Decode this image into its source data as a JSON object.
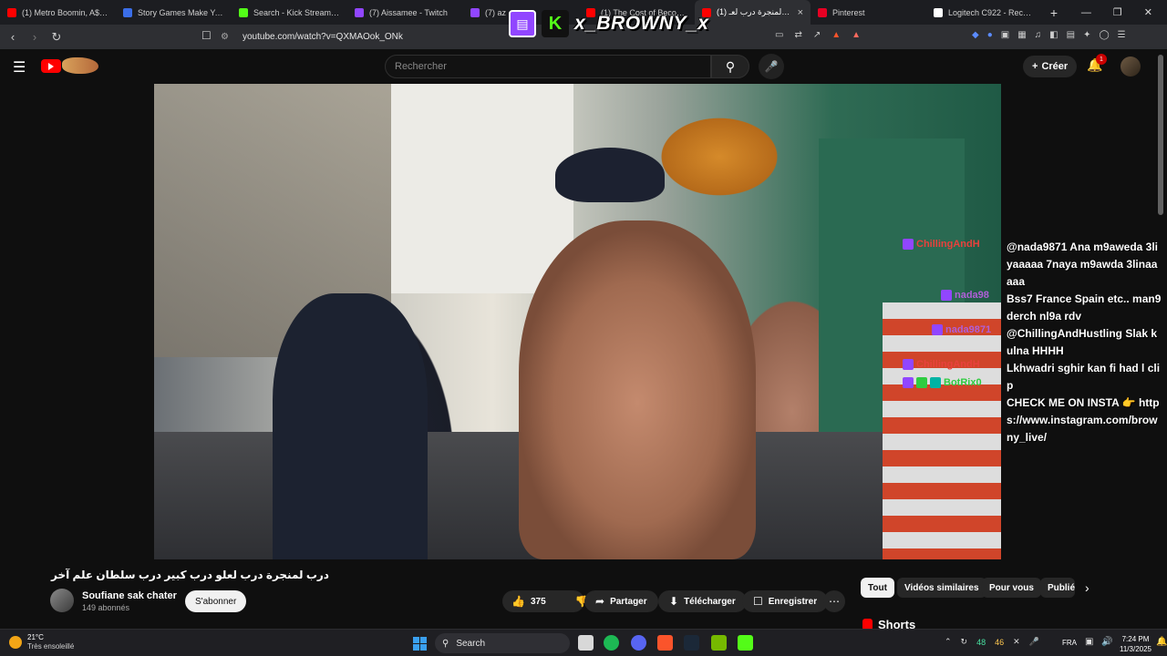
{
  "browser": {
    "tabs": [
      {
        "title": "(1) Metro Boomin, A$AP R",
        "icon": "youtube-icon",
        "color": "#ff0000"
      },
      {
        "title": "Story Games Make You Co",
        "icon": "r-icon",
        "color": "#3b6ee8"
      },
      {
        "title": "Search - Kick Streaming",
        "icon": "kick-icon",
        "color": "#53fc18"
      },
      {
        "title": "(7) Aissamee - Twitch",
        "icon": "twitch-icon",
        "color": "#9146ff"
      },
      {
        "title": "(7) az",
        "icon": "twitch-icon",
        "color": "#9146ff"
      },
      {
        "title": "(1) The Cost of Becoming",
        "icon": "youtube-icon",
        "color": "#ff0000"
      },
      {
        "title": "(1) درب لمنجرة درب لعـ",
        "icon": "youtube-icon",
        "color": "#ff0000",
        "active": true
      },
      {
        "title": "Pinterest",
        "icon": "pinterest-icon",
        "color": "#e60023"
      },
      {
        "title": "Logitech C922 - Recherche",
        "icon": "google-icon",
        "color": "#ffffff"
      }
    ],
    "url": "youtube.com/watch?v=QXMAOok_ONk"
  },
  "overlay": {
    "streamer_name": "x_BROWNY_x"
  },
  "youtube": {
    "search_placeholder": "Rechercher",
    "create_label": "Créer",
    "notification_count": "1"
  },
  "chat": {
    "usernames": [
      {
        "name": "ChillingAndH",
        "color": "#e8413c",
        "badges": [
          "twitch"
        ]
      },
      {
        "name": "nada98",
        "color": "#b05fd8",
        "badges": [
          "twitch"
        ]
      },
      {
        "name": "nada9871",
        "color": "#b05fd8",
        "badges": [
          "twitch"
        ]
      },
      {
        "name": "ChillingAndH",
        "color": "#e8413c",
        "badges": [
          "twitch"
        ]
      },
      {
        "name": "BotRix0",
        "color": "#2ecc40",
        "badges": [
          "twitch",
          "green",
          "cyan"
        ]
      }
    ],
    "messages": [
      "@nada9871 Ana m9aweda 3liyaaaaa 7naya m9awda 3linaaaaa",
      "Bss7 France Spain etc.. man9derch nl9a rdv",
      "@ChillingAndHustling Slak kulna HHHH",
      "Lkhwadri sghir kan fi had l clip",
      "CHECK ME ON INSTA 👉 https://www.instagram.com/browny_live/"
    ]
  },
  "video": {
    "title": "درب لمنجرة درب لعلو درب كبير درب سلطان علم آخر",
    "channel_name": "Soufiane sak chater",
    "subscribers": "149 abonnés",
    "subscribe_label": "S'abonner",
    "like_count": "375",
    "share_label": "Partager",
    "download_label": "Télécharger",
    "save_label": "Enregistrer"
  },
  "chips": [
    "Tout",
    "Vidéos similaires",
    "Pour vous",
    "Publié"
  ],
  "shorts_label": "Shorts",
  "taskbar": {
    "temperature": "21°C",
    "condition": "Très ensoleillé",
    "search_label": "Search",
    "tray_num1": "48",
    "tray_num2": "46",
    "language": "FRA",
    "time": "7:24 PM",
    "date": "11/3/2025"
  }
}
